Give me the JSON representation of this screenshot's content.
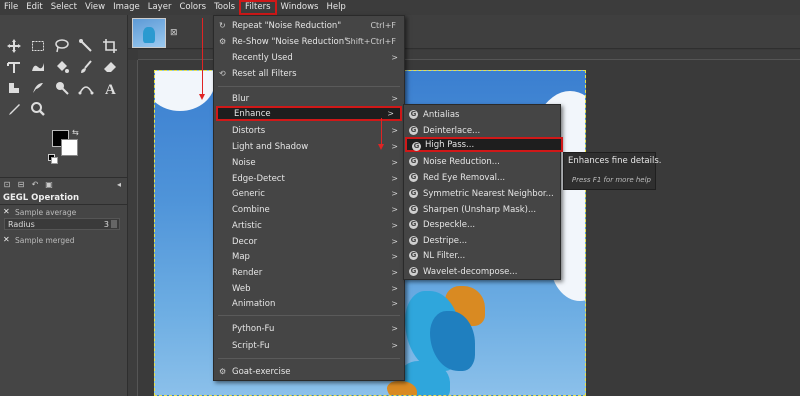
{
  "menubar": {
    "items": [
      "File",
      "Edit",
      "Select",
      "View",
      "Image",
      "Layer",
      "Colors",
      "Tools",
      "Filters",
      "Windows",
      "Help"
    ],
    "active": "Filters"
  },
  "toolbox": {
    "tool_icons": [
      "move-icon",
      "rect-select-icon",
      "lasso-icon",
      "fuzzy-select-icon",
      "crop-icon",
      "transform-icon",
      "warp-icon",
      "bucket-fill-icon",
      "paintbrush-icon",
      "eraser-icon",
      "clone-icon",
      "smudge-icon",
      "dodge-icon",
      "path-icon",
      "text-icon",
      "color-picker-icon",
      "zoom-icon"
    ]
  },
  "tool_options": {
    "title": "GEGL Operation",
    "sample_average": "Sample average",
    "radius_label": "Radius",
    "radius_value": "3",
    "sample_merged": "Sample merged"
  },
  "thumb_close": "⊠",
  "filters_menu": {
    "items": [
      {
        "label": "Repeat \"Noise Reduction\"",
        "shortcut": "Ctrl+F",
        "icon": "repeat-icon"
      },
      {
        "label": "Re-Show \"Noise Reduction\"",
        "shortcut": "Shift+Ctrl+F",
        "icon": "reshow-icon"
      },
      {
        "label": "Recently Used",
        "submenu": true
      },
      {
        "label": "Reset all Filters",
        "icon": "reset-icon"
      },
      {
        "label": "Blur",
        "submenu": true
      },
      {
        "label": "Enhance",
        "submenu": true,
        "active": true
      },
      {
        "label": "Distorts",
        "submenu": true
      },
      {
        "label": "Light and Shadow",
        "submenu": true
      },
      {
        "label": "Noise",
        "submenu": true
      },
      {
        "label": "Edge-Detect",
        "submenu": true
      },
      {
        "label": "Generic",
        "submenu": true
      },
      {
        "label": "Combine",
        "submenu": true
      },
      {
        "label": "Artistic",
        "submenu": true
      },
      {
        "label": "Decor",
        "submenu": true
      },
      {
        "label": "Map",
        "submenu": true
      },
      {
        "label": "Render",
        "submenu": true
      },
      {
        "label": "Web",
        "submenu": true
      },
      {
        "label": "Animation",
        "submenu": true
      },
      {
        "label": "Python-Fu",
        "submenu": true
      },
      {
        "label": "Script-Fu",
        "submenu": true
      },
      {
        "label": "Goat-exercise",
        "icon": "goat-icon"
      }
    ]
  },
  "enhance_submenu": {
    "items": [
      {
        "label": "Antialias"
      },
      {
        "label": "Deinterlace..."
      },
      {
        "label": "High Pass...",
        "highlighted": true
      },
      {
        "label": "Noise Reduction..."
      },
      {
        "label": "Red Eye Removal..."
      },
      {
        "label": "Symmetric Nearest Neighbor..."
      },
      {
        "label": "Sharpen (Unsharp Mask)..."
      },
      {
        "label": "Despeckle..."
      },
      {
        "label": "Destripe..."
      },
      {
        "label": "NL Filter..."
      },
      {
        "label": "Wavelet-decompose..."
      }
    ]
  },
  "tooltip": {
    "text": "Enhances fine details.",
    "hint": "Press F1 for more help"
  },
  "colors": {
    "annotation_red": "#d01818",
    "menu_bg": "#454545",
    "highlight_bg": "#1e1e1e"
  }
}
